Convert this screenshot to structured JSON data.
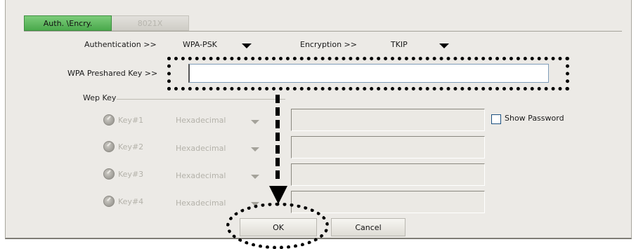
{
  "tabs": [
    {
      "label": "Auth. \\Encry.",
      "active": true
    },
    {
      "label": "8021X",
      "active": false
    }
  ],
  "authentication": {
    "label": "Authentication >>",
    "value": "WPA-PSK"
  },
  "encryption": {
    "label": "Encryption >>",
    "value": "TKIP"
  },
  "preshared_key": {
    "label": "WPA Preshared Key >>",
    "value": ""
  },
  "wep": {
    "title": "Wep Key",
    "keys": [
      {
        "label": "Key#1",
        "format": "Hexadecimal"
      },
      {
        "label": "Key#2",
        "format": "Hexadecimal"
      },
      {
        "label": "Key#3",
        "format": "Hexadecimal"
      },
      {
        "label": "Key#4",
        "format": "Hexadecimal"
      }
    ]
  },
  "show_password": {
    "label": "Show Password",
    "checked": false
  },
  "buttons": {
    "ok": "OK",
    "cancel": "Cancel"
  },
  "colors": {
    "active_tab": "#5cb85c",
    "panel": "#eceae6",
    "annotation": "#000000"
  }
}
